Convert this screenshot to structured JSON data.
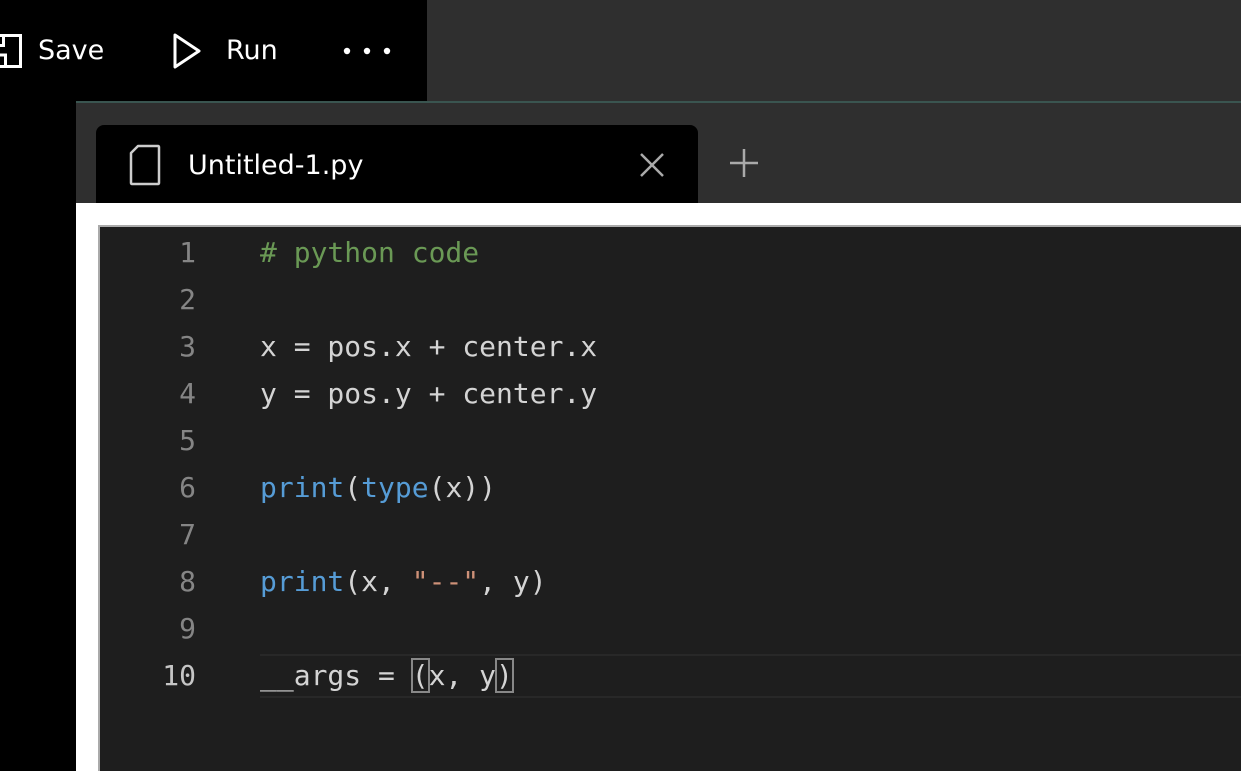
{
  "toolbar": {
    "save_label": "Save",
    "run_label": "Run",
    "more_label": "More"
  },
  "icons": {
    "save": "save-icon",
    "run": "play-icon",
    "more": "more-icon",
    "file": "file-icon",
    "close": "close-icon",
    "add": "plus-icon"
  },
  "tabs": [
    {
      "title": "Untitled-1.py",
      "active": true
    }
  ],
  "editor": {
    "active_line": 10,
    "line_numbers": [
      "1",
      "2",
      "3",
      "4",
      "5",
      "6",
      "7",
      "8",
      "9",
      "10"
    ],
    "lines": [
      [
        {
          "t": "# python code",
          "k": "comment"
        }
      ],
      [],
      [
        {
          "t": "x = pos.x + center.x",
          "k": "plain"
        }
      ],
      [
        {
          "t": "y = pos.y + center.y",
          "k": "plain"
        }
      ],
      [],
      [
        {
          "t": "print",
          "k": "builtin"
        },
        {
          "t": "(",
          "k": "plain"
        },
        {
          "t": "type",
          "k": "builtin"
        },
        {
          "t": "(x))",
          "k": "plain"
        }
      ],
      [],
      [
        {
          "t": "print",
          "k": "builtin"
        },
        {
          "t": "(x, ",
          "k": "plain"
        },
        {
          "t": "\"--\"",
          "k": "string"
        },
        {
          "t": ", y)",
          "k": "plain"
        }
      ],
      [],
      [
        {
          "t": "__args = ",
          "k": "plain"
        },
        {
          "t": "(",
          "k": "plain",
          "bracket": true
        },
        {
          "t": "x, y",
          "k": "plain"
        },
        {
          "t": ")",
          "k": "plain",
          "bracket": true
        }
      ]
    ]
  },
  "colors": {
    "background": "#000000",
    "toolbar_fill": "#2f2f2f",
    "editor_bg": "#1e1e1e",
    "comment": "#6a9955",
    "builtin": "#569cd6",
    "string": "#ce9178",
    "text": "#d4d4d4",
    "line_number": "#858585"
  }
}
